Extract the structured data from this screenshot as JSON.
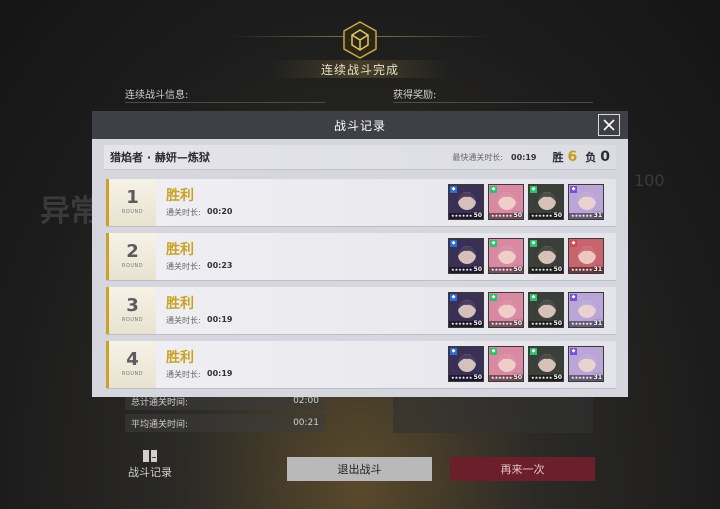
{
  "background": {
    "title": "连续战斗完成",
    "info_label": "连续战斗信息:",
    "reward_label": "获得奖励:",
    "total_time_label": "总计通关时间:",
    "total_time": "02:00",
    "avg_time_label": "平均通关时间:",
    "avg_time": "00:21",
    "record_label": "战斗记录",
    "exit_button": "退出战斗",
    "retry_button": "再来一次",
    "left_deco_text": "异常",
    "right_deco_number": "100"
  },
  "modal": {
    "title": "战斗记录",
    "stage_name": "猎焰者 · 赫妍—炼狱",
    "fastest_label": "最快通关时长:",
    "fastest_time": "00:19",
    "win_label": "胜",
    "win_count": "6",
    "loss_label": "负",
    "loss_count": "0",
    "round_word": "ROUND",
    "time_label": "通关时长:",
    "rounds": [
      {
        "number": "1",
        "result": "胜利",
        "time": "00:20",
        "team": [
          {
            "icon": "dark-hair-character-portrait",
            "level": "50",
            "color": "#3a2f55",
            "badge": "#2b6fd6"
          },
          {
            "icon": "pink-hair-character-portrait",
            "level": "50",
            "color": "#d98aa2",
            "badge": "#2fbf6a"
          },
          {
            "icon": "masked-character-portrait",
            "level": "50",
            "color": "#3b3f3a",
            "badge": "#2fbf6a"
          },
          {
            "icon": "white-hair-character-portrait",
            "level": "31",
            "color": "#b9a6d6",
            "badge": "#7a4fd6"
          }
        ]
      },
      {
        "number": "2",
        "result": "胜利",
        "time": "00:23",
        "team": [
          {
            "icon": "dark-hair-character-portrait",
            "level": "50",
            "color": "#3a2f55",
            "badge": "#2b6fd6"
          },
          {
            "icon": "pink-hair-character-portrait",
            "level": "50",
            "color": "#d98aa2",
            "badge": "#2fbf6a"
          },
          {
            "icon": "masked-character-portrait",
            "level": "50",
            "color": "#3b3f3a",
            "badge": "#2fbf6a"
          },
          {
            "icon": "red-hair-character-portrait",
            "level": "31",
            "color": "#c8646e",
            "badge": "#d04a4a"
          }
        ]
      },
      {
        "number": "3",
        "result": "胜利",
        "time": "00:19",
        "team": [
          {
            "icon": "dark-hair-character-portrait",
            "level": "50",
            "color": "#3a2f55",
            "badge": "#2b6fd6"
          },
          {
            "icon": "pink-hair-character-portrait",
            "level": "50",
            "color": "#d98aa2",
            "badge": "#2fbf6a"
          },
          {
            "icon": "masked-character-portrait",
            "level": "50",
            "color": "#3b3f3a",
            "badge": "#2fbf6a"
          },
          {
            "icon": "white-hair-character-portrait",
            "level": "31",
            "color": "#b9a6d6",
            "badge": "#7a4fd6"
          }
        ]
      },
      {
        "number": "4",
        "result": "胜利",
        "time": "00:19",
        "team": [
          {
            "icon": "dark-hair-character-portrait",
            "level": "50",
            "color": "#3a2f55",
            "badge": "#2b6fd6"
          },
          {
            "icon": "pink-hair-character-portrait",
            "level": "50",
            "color": "#d98aa2",
            "badge": "#2fbf6a"
          },
          {
            "icon": "masked-character-portrait",
            "level": "50",
            "color": "#3b3f3a",
            "badge": "#2fbf6a"
          },
          {
            "icon": "white-hair-character-portrait",
            "level": "31",
            "color": "#b9a6d6",
            "badge": "#7a4fd6"
          }
        ]
      }
    ]
  },
  "colors": {
    "accent_gold": "#c9a227",
    "modal_header": "#3f4047",
    "retry_button": "#6a1f2a"
  }
}
